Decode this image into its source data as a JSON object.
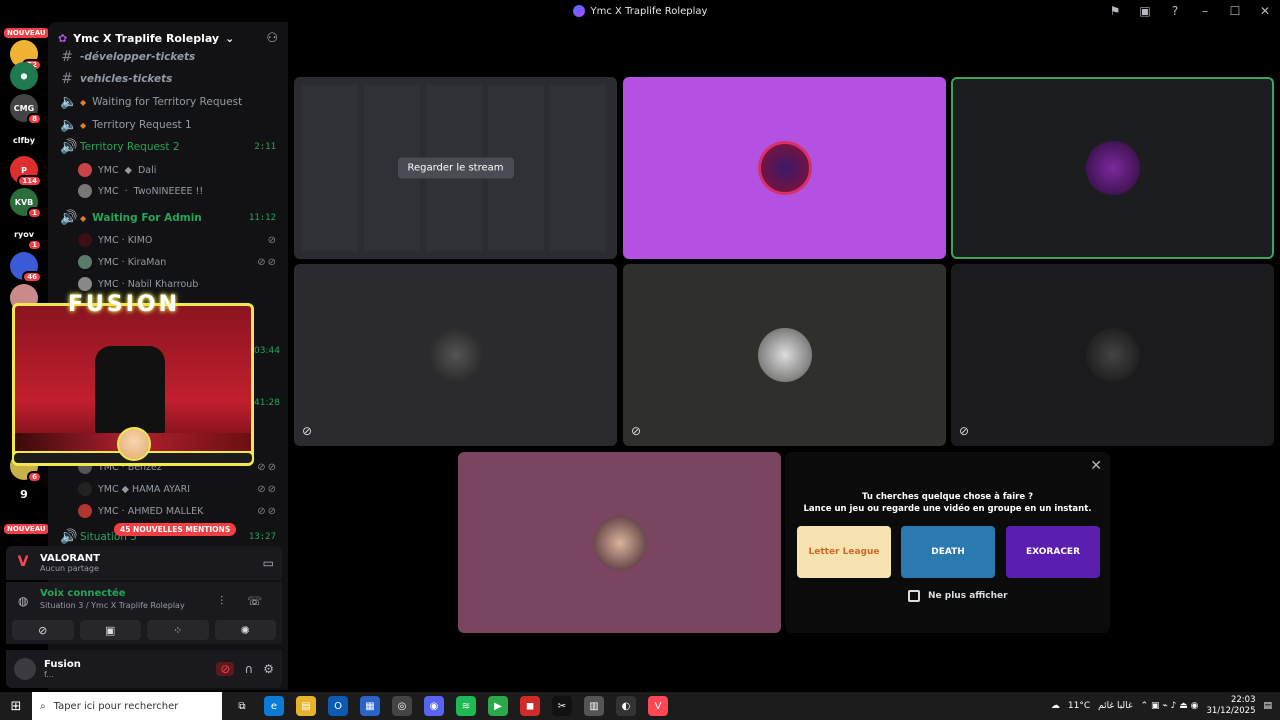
{
  "window": {
    "title": "Ymc X Traplife Roleplay"
  },
  "rail": {
    "badges": [
      {
        "label": "NOUVEAU",
        "count": "52"
      },
      {
        "label": "",
        "count": ""
      },
      {
        "label": "CMG",
        "count": "8"
      },
      {
        "label": "clfby",
        "count": ""
      },
      {
        "label": "",
        "count": "114"
      },
      {
        "label": "KVB",
        "count": "1"
      },
      {
        "label": "ryov",
        "count": "1"
      },
      {
        "label": "",
        "count": "46"
      },
      {
        "label": "",
        "count": "6"
      },
      {
        "label": "9",
        "count": ""
      },
      {
        "label": "NOUVEAU",
        "count": ""
      }
    ]
  },
  "sidebar": {
    "server_name": "Ymc X Traplife Roleplay",
    "channels": [
      {
        "icon": "#",
        "name": "-développer-tickets",
        "time": "",
        "live": false
      },
      {
        "icon": "#",
        "name": "vehicles-tickets",
        "time": "",
        "live": false
      },
      {
        "icon": "🔊",
        "name": "Waiting for Territory Request",
        "time": "",
        "live": false
      },
      {
        "icon": "🔊",
        "name": "Territory Request 1",
        "time": "",
        "live": false
      },
      {
        "icon": "🔊",
        "name": "Territory Request 2",
        "time": "2:11",
        "live": true
      }
    ],
    "users_tr2": [
      {
        "name": "YMC",
        "sep": "◆",
        "name2": "Dali"
      },
      {
        "name": "YMC",
        "sep": "·",
        "name2": "TwoNINEEEE !!"
      }
    ],
    "admin_channel": {
      "name": "Waiting For Admin",
      "time": "11:12"
    },
    "users_admin": [
      {
        "name": "YMC · KIMO"
      },
      {
        "name": "YMC · KiraMan"
      },
      {
        "name": "YMC · Nabil Kharroub"
      }
    ],
    "hidden_times": [
      "03:44",
      "41:28"
    ],
    "users_bottom": [
      {
        "name": "YMC · Benzez"
      },
      {
        "name": "YMC ◆ HAMA AYARI"
      },
      {
        "name": "YMC · AHMED MALLEK"
      }
    ],
    "situation": {
      "name": "Situation 3",
      "time": "13:27"
    },
    "mentions": "45 NOUVELLES MENTIONS",
    "overlay_logo": "FUSION"
  },
  "activity": {
    "title": "VALORANT",
    "subtitle": "Aucun partage"
  },
  "voice": {
    "status": "Voix connectée",
    "channel": "Situation 3 / Ymc X Traplife Roleplay"
  },
  "userbar": {
    "name": "Fusion",
    "status": "f..."
  },
  "stage": {
    "watch_label": "Regarder le stream",
    "tile_colors": {
      "purple": "#b352e0",
      "pink": "#7a4561"
    }
  },
  "prompt": {
    "line1": "Tu cherches quelque chose à faire ?",
    "line2": "Lance un jeu ou regarde une vidéo en groupe en un instant.",
    "games": [
      {
        "name": "Letter League"
      },
      {
        "name": "DEATH"
      },
      {
        "name": "EXORACER"
      }
    ],
    "checkbox_label": "Ne plus afficher"
  },
  "taskbar": {
    "search_placeholder": "Taper ici pour rechercher",
    "weather": "11°C",
    "weather_text": "غالبا غائم",
    "time": "22:03",
    "date": "31/12/2025"
  }
}
